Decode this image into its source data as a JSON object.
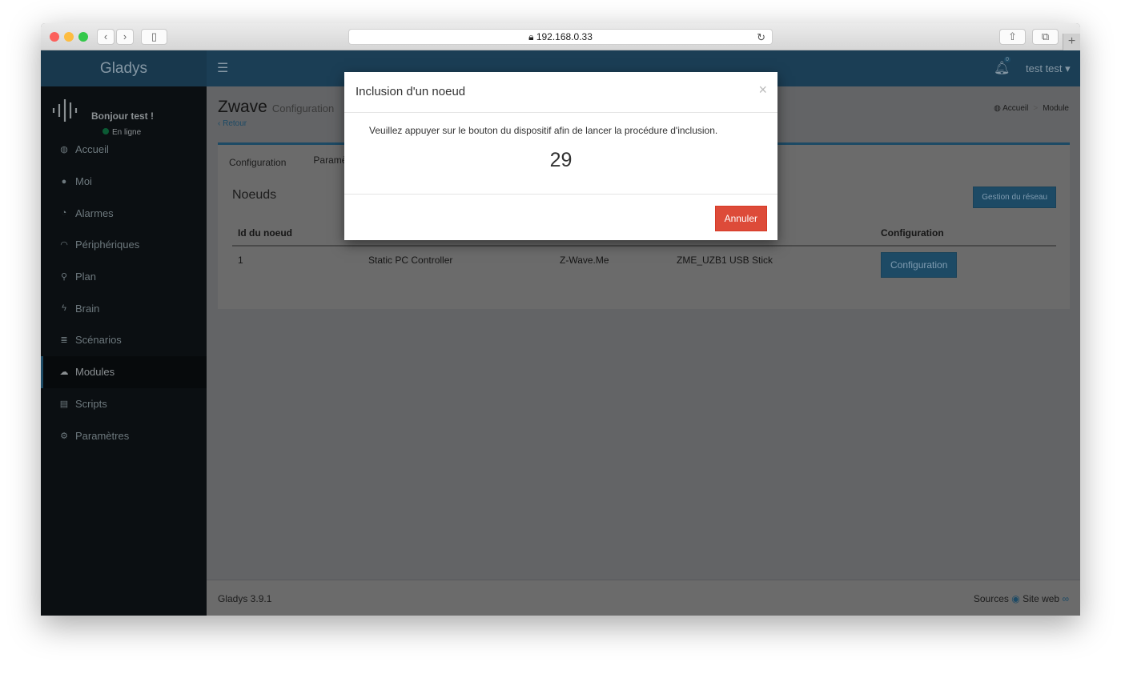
{
  "browser": {
    "url": "192.168.0.33",
    "back": "‹",
    "forward": "›"
  },
  "header": {
    "brand": "Gladys",
    "notifications_count": "0",
    "user": "test test ▾"
  },
  "sidebar": {
    "greeting": "Bonjour test !",
    "status": "En ligne",
    "items": [
      {
        "label": "Accueil",
        "icon": "dashboard-icon",
        "glyph": "◍"
      },
      {
        "label": "Moi",
        "icon": "user-icon",
        "glyph": "●"
      },
      {
        "label": "Alarmes",
        "icon": "clock-icon",
        "glyph": "◔"
      },
      {
        "label": "Périphériques",
        "icon": "rss-icon",
        "glyph": "◠"
      },
      {
        "label": "Plan",
        "icon": "map-marker-icon",
        "glyph": "⚲"
      },
      {
        "label": "Brain",
        "icon": "bolt-icon",
        "glyph": "ϟ"
      },
      {
        "label": "Scénarios",
        "icon": "list-icon",
        "glyph": "≣"
      },
      {
        "label": "Modules",
        "icon": "cloud-download-icon",
        "glyph": "☁"
      },
      {
        "label": "Scripts",
        "icon": "file-icon",
        "glyph": "▤"
      },
      {
        "label": "Paramètres",
        "icon": "gear-icon",
        "glyph": "⚙"
      }
    ],
    "active": "Modules"
  },
  "page": {
    "title": "Zwave",
    "subtitle": "Configuration",
    "back": "‹ Retour",
    "breadcrumb": [
      "Accueil",
      "Module"
    ]
  },
  "box": {
    "tabs": [
      "Configuration",
      "Paramè"
    ],
    "title": "Noeuds",
    "network_button": "Gestion du réseau",
    "columns": [
      "Id du noeud",
      "",
      "",
      "",
      "Configuration"
    ],
    "rows": [
      {
        "id": "1",
        "type": "Static PC Controller",
        "manufacturer": "Z-Wave.Me",
        "product": "ZME_UZB1 USB Stick",
        "action": "Configuration"
      }
    ]
  },
  "footer": {
    "version": "Gladys 3.9.1",
    "sources": "Sources",
    "site": "Site web"
  },
  "modal": {
    "title": "Inclusion d'un noeud",
    "message": "Veuillez appuyer sur le bouton du dispositif afin de lancer la procédure d'inclusion.",
    "countdown": "29",
    "cancel": "Annuler",
    "close": "×"
  },
  "colors": {
    "primary": "#3c8dbc",
    "danger": "#dd4b39",
    "online": "#00a65a"
  }
}
